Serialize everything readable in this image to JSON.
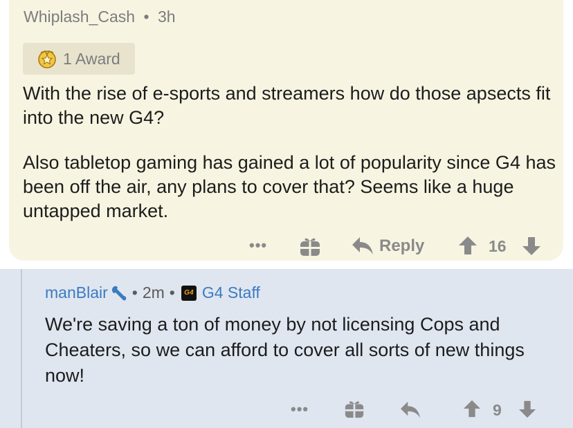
{
  "parent_comment": {
    "username": "Whiplash_Cash",
    "separator": "•",
    "age": "3h",
    "award_label": "1 Award",
    "body": [
      "With the rise of e-sports and streamers how do those apsects fit into the new G4?",
      "Also tabletop gaming has gained a lot of popularity since G4 has been off the air, any plans to cover that? Seems like a huge untapped market."
    ],
    "actions": {
      "more": "•••",
      "reply_label": "Reply",
      "score": "16"
    }
  },
  "reply_comment": {
    "username": "manBlair",
    "separator": "•",
    "age": "2m",
    "flair_text": "G4 Staff",
    "flair_badge_text": "G4",
    "body": [
      "We're saving a ton of money by not licensing Cops and Cheaters, so we can afford to cover all sorts of new things now!"
    ],
    "actions": {
      "more": "•••",
      "score": "9"
    }
  },
  "colors": {
    "parent_background": "#f7f4e1",
    "reply_background": "#dfe6f0",
    "username_blue": "#3b7bc0",
    "muted_gray": "#8a8a8a"
  },
  "icons": [
    "award-icon",
    "gift-icon",
    "reply-arrow-icon",
    "upvote-icon",
    "downvote-icon",
    "mod-wrench-icon",
    "g4-badge-icon"
  ]
}
